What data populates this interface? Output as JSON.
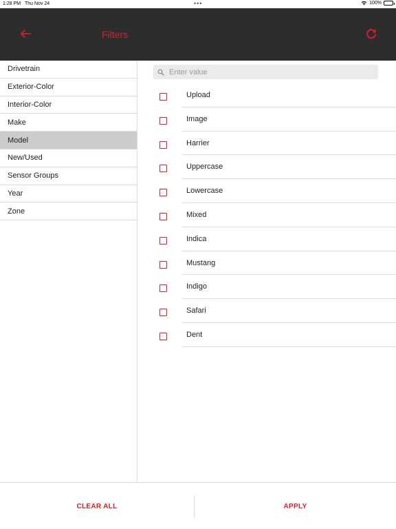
{
  "status_bar": {
    "time": "1:28 PM",
    "date": "Thu Nov 24",
    "dots": "•••",
    "battery": "100%"
  },
  "header": {
    "title": "Filters",
    "back_icon": "arrow-left-icon",
    "refresh_icon": "refresh-icon"
  },
  "sidebar": {
    "items": [
      {
        "label": "Drivetrain"
      },
      {
        "label": "Exterior-Color"
      },
      {
        "label": "Interior-Color"
      },
      {
        "label": "Make"
      },
      {
        "label": "Model"
      },
      {
        "label": "New/Used"
      },
      {
        "label": "Sensor Groups"
      },
      {
        "label": "Year"
      },
      {
        "label": "Zone"
      }
    ],
    "selected": "Model"
  },
  "search": {
    "placeholder": "Enter value",
    "value": ""
  },
  "options": [
    {
      "label": "Upload",
      "checked": false
    },
    {
      "label": "Image",
      "checked": false
    },
    {
      "label": "Harrier",
      "checked": false
    },
    {
      "label": "Uppercase",
      "checked": false
    },
    {
      "label": "Lowercase",
      "checked": false
    },
    {
      "label": "Mixed",
      "checked": false
    },
    {
      "label": "Indica",
      "checked": false
    },
    {
      "label": "Mustang",
      "checked": false
    },
    {
      "label": "Indigo",
      "checked": false
    },
    {
      "label": "Safari",
      "checked": false
    },
    {
      "label": "Dent",
      "checked": false
    }
  ],
  "footer": {
    "clear_label": "CLEAR ALL",
    "apply_label": "APPLY"
  },
  "colors": {
    "accent": "#d41f2c",
    "header_bg": "#2d2d2d",
    "selected_bg": "#cccccc"
  }
}
